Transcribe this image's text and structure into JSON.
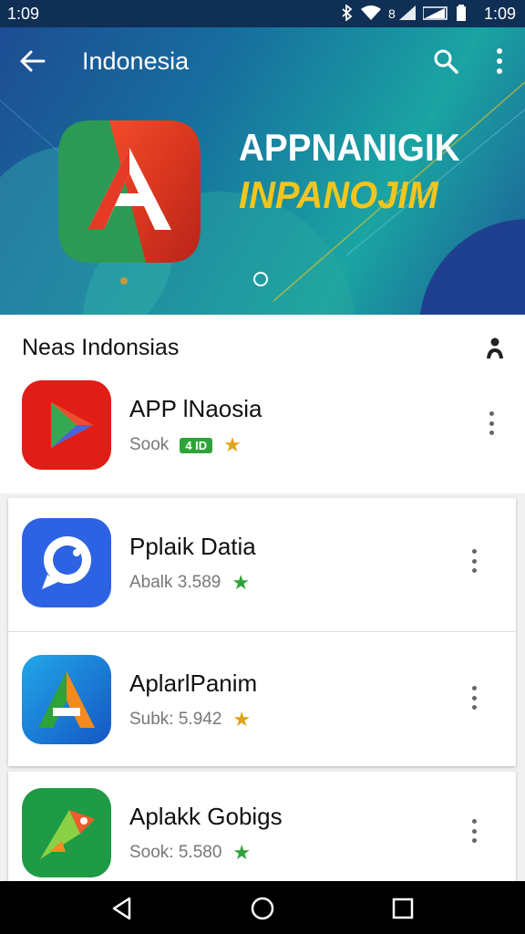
{
  "status_bar": {
    "time_left": "1:09",
    "time_right": "1:09"
  },
  "app_bar": {
    "title": "Indonesia",
    "back_icon": "arrow-back-icon",
    "search_icon": "search-icon",
    "more_icon": "more-vert-icon"
  },
  "banner": {
    "line1": "APPNANIGIK",
    "line2": "INPANOJIM",
    "colors": {
      "accent": "#f4c51c",
      "bg_start": "#1d4d93",
      "bg_end": "#1aa4a2"
    }
  },
  "section": {
    "title": "Neas Indonsias",
    "icon": "person-icon"
  },
  "apps": [
    {
      "name": "APP lNaosia",
      "sub": "Sook",
      "badge": "4 ID",
      "star_color": "#e0a21a"
    },
    {
      "name": "Pplaik Datia",
      "sub": "Abalk 3.589",
      "star_color": "#2ea33a"
    },
    {
      "name": "AplarlPanim",
      "sub": "Subk: 5.942",
      "star_color": "#e0a21a"
    },
    {
      "name": "Aplakk Gobigs",
      "sub": "Sook: 5.580",
      "star_color": "#2ea33a"
    }
  ],
  "nav": {
    "back_icon": "nav-back-icon",
    "home_icon": "nav-home-icon",
    "recents_icon": "nav-recents-icon"
  }
}
